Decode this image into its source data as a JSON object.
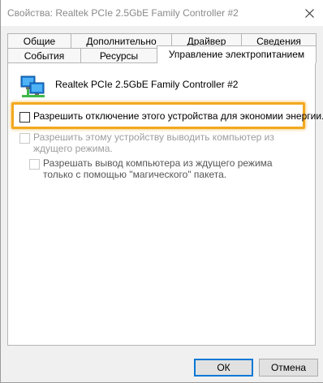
{
  "window": {
    "title": "Свойства: Realtek PCIe 2.5GbE Family Controller #2"
  },
  "tabs": {
    "row_top": [
      "Общие",
      "Дополнительно",
      "Драйвер",
      "Сведения"
    ],
    "row_bottom": [
      "События",
      "Ресурсы",
      "Управление электропитанием"
    ],
    "active": "Управление электропитанием"
  },
  "device": {
    "name": "Realtek PCIe 2.5GbE Family Controller #2",
    "icon": "network-adapter-icon"
  },
  "options": [
    {
      "label": "Разрешить отключение этого устройства для экономии энергии.",
      "checked": false,
      "enabled": true
    },
    {
      "label": "Разрешить этому устройству выводить компьютер из ждущего режима.",
      "checked": false,
      "enabled": false
    },
    {
      "label": "Разрешать вывод компьютера из ждущего режима только с помощью \"магического\" пакета.",
      "checked": false,
      "enabled": false
    }
  ],
  "buttons": {
    "ok": "ОК",
    "cancel": "Отмена"
  },
  "colors": {
    "highlight": "#f2a81f",
    "default_button_border": "#0078d7"
  }
}
